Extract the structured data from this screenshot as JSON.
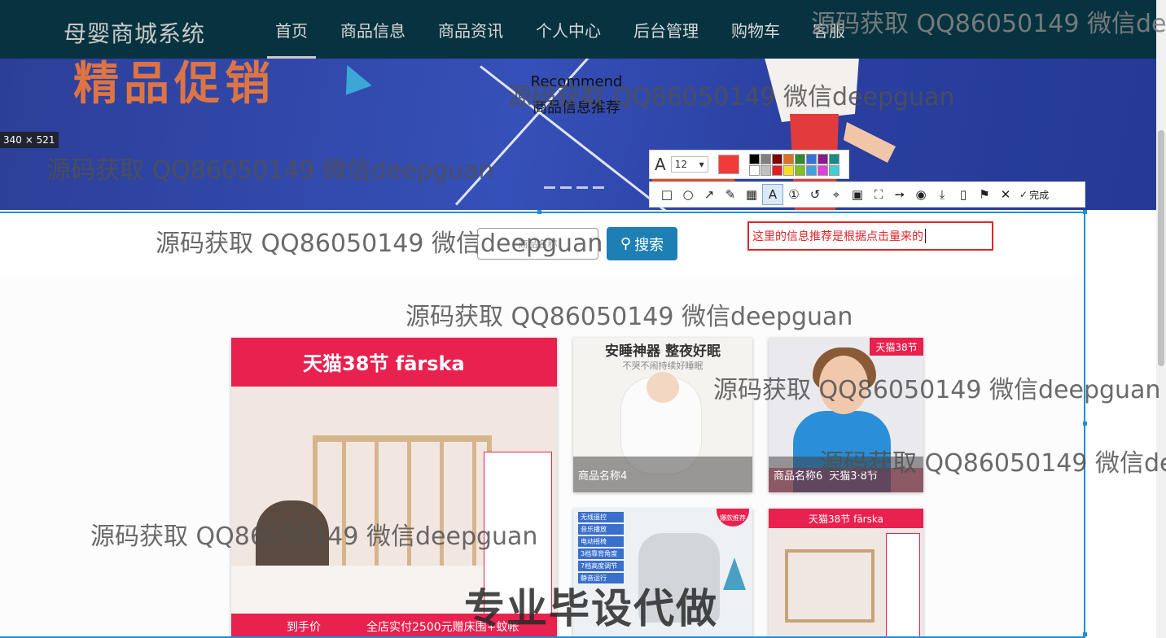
{
  "nav": {
    "logo": "母婴商城系统",
    "items": [
      "首页",
      "商品信息",
      "商品资讯",
      "个人中心",
      "后台管理",
      "购物车",
      "客服"
    ],
    "active_index": 0
  },
  "banner": {
    "text": "精品促销"
  },
  "size_indicator": "340 × 521",
  "annotation_toolbar": {
    "font_label": "A",
    "font_size": "12",
    "current_color": "#f23a3a",
    "palette": [
      "#000000",
      "#808080",
      "#800000",
      "#e07020",
      "#2e8b2e",
      "#3a6fd8",
      "#8b1a8b",
      "#1a8b8b",
      "#ffffff",
      "#c0c0c0",
      "#e02020",
      "#f0e020",
      "#80c020",
      "#40a0e0",
      "#e040e0",
      "#40d0d0"
    ],
    "tools": [
      "rectangle-icon",
      "ellipse-icon",
      "arrow-icon",
      "pencil-icon",
      "mosaic-icon",
      "text-icon",
      "number-icon",
      "undo-icon",
      "crop-icon",
      "ocr-icon",
      "scan-icon",
      "pin-icon",
      "record-icon",
      "download-icon",
      "save-icon",
      "bookmark-icon",
      "close-icon",
      "check-icon"
    ],
    "done_label": "完成"
  },
  "search": {
    "placeholder": "商品名称",
    "button_label": "搜索"
  },
  "annotation_note": "这里的信息推荐是根据点击量来的",
  "recommend": {
    "title_en": "Recommend",
    "title_cn": "商品信息推荐"
  },
  "products": [
    {
      "caption": "",
      "banner": "天猫38节 fārska",
      "footer_left": "到手价",
      "footer_right": "全店实付2500元赠床围+蚊帐"
    },
    {
      "caption": "商品名称4",
      "headline": "安睡神器 整夜好眠",
      "sub": "不哭不闹持续好睡眠"
    },
    {
      "caption": "商品名称6",
      "tag": "天猫38节",
      "promo": "天猫3·8节"
    },
    {
      "caption": "",
      "features": [
        "无线遥控",
        "音乐播放",
        "电动摇椅",
        "3档靠背角度",
        "7档高度调节",
        "静音运行"
      ],
      "badge": "爆款推荐"
    },
    {
      "caption": "",
      "banner": "天猫38节 fārska"
    }
  ],
  "watermarks": [
    "源码获取 QQ86050149 微信deepguan",
    "源码获取 QQ86050149 微信deepguan",
    "源码获取 QQ86050149 微信deepguan",
    "源码获取 QQ86050149 微信deepguan",
    "源码获取 QQ86050149 微信deepguan",
    "源码获取 QQ86050149 微信deepguan",
    "源码获取 QQ86050149 微信deepguan",
    "源码获取 QQ86050149 微信deepguan"
  ],
  "overlay_text": "专业毕设代做"
}
